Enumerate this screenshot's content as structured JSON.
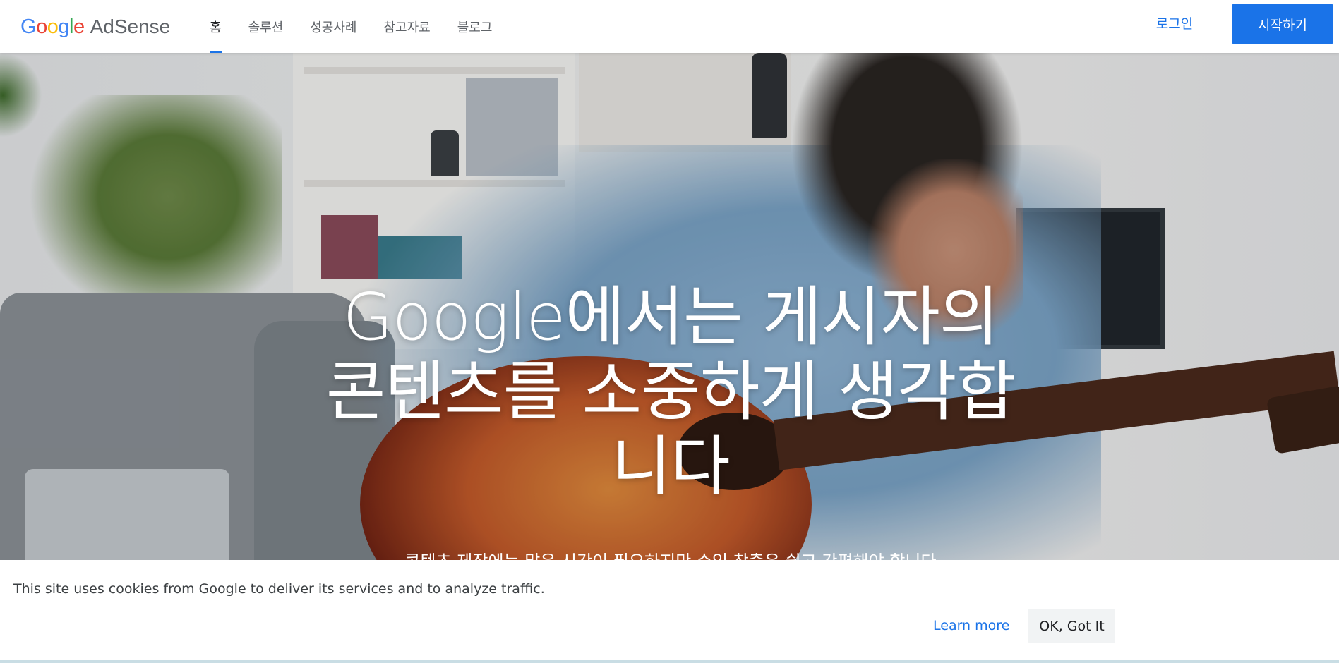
{
  "header": {
    "logo": {
      "letters": [
        {
          "char": "G",
          "color": "#4285F4"
        },
        {
          "char": "o",
          "color": "#EA4335"
        },
        {
          "char": "o",
          "color": "#FBBC05"
        },
        {
          "char": "g",
          "color": "#4285F4"
        },
        {
          "char": "l",
          "color": "#34A853"
        },
        {
          "char": "e",
          "color": "#EA4335"
        }
      ],
      "product": "AdSense"
    },
    "nav": [
      {
        "label": "홈",
        "active": true
      },
      {
        "label": "솔루션",
        "active": false
      },
      {
        "label": "성공사례",
        "active": false
      },
      {
        "label": "참고자료",
        "active": false
      },
      {
        "label": "블로그",
        "active": false
      }
    ],
    "login_label": "로그인",
    "start_label": "시작하기"
  },
  "hero": {
    "title": "Google에서는 게시자의 콘텐츠를 소중하게 생각합니다",
    "subtitle": "콘텐츠 제작에는 많은 시간이 필요하지만 수익 창출은 쉽고 간편해야 합니다"
  },
  "cookie_bar": {
    "text": "This site uses cookies from Google to deliver its services and to analyze traffic.",
    "learn_more_label": "Learn more",
    "ok_label": "OK, Got It"
  },
  "colors": {
    "accent": "#1a73e8",
    "nav_text": "#5f6368"
  }
}
